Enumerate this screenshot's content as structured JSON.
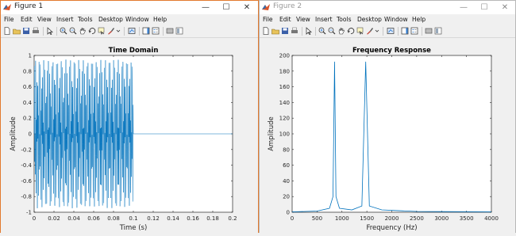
{
  "windows": [
    {
      "title": "Figure 1",
      "minimize": "—",
      "maximize": "☐",
      "close": "✕",
      "menus": [
        "File",
        "Edit",
        "View",
        "Insert",
        "Tools",
        "Desktop",
        "Window",
        "Help"
      ],
      "plot": {
        "title": "Time Domain",
        "xlabel": "Time (s)",
        "ylabel": "Amplitude",
        "xlim": [
          0,
          0.2
        ],
        "ylim": [
          -1,
          1
        ],
        "xticks": [
          "0",
          "0.02",
          "0.04",
          "0.06",
          "0.08",
          "0.1",
          "0.12",
          "0.14",
          "0.16",
          "0.18",
          "0.2"
        ],
        "yticks": [
          "-1",
          "-0.8",
          "-0.6",
          "-0.4",
          "-0.2",
          "0",
          "0.2",
          "0.4",
          "0.6",
          "0.8",
          "1"
        ],
        "line_color": "#0072bd"
      }
    },
    {
      "title": "Figure 2",
      "minimize": "—",
      "maximize": "☐",
      "close": "✕",
      "menus": [
        "File",
        "Edit",
        "View",
        "Insert",
        "Tools",
        "Desktop",
        "Window",
        "Help"
      ],
      "plot": {
        "title": "Frequency Response",
        "xlabel": "Frequency (Hz)",
        "ylabel": "Amplitude",
        "xlim": [
          0,
          4000
        ],
        "ylim": [
          0,
          200
        ],
        "xticks": [
          "0",
          "500",
          "1000",
          "1500",
          "2000",
          "2500",
          "3000",
          "3500",
          "4000"
        ],
        "yticks": [
          "0",
          "20",
          "40",
          "60",
          "80",
          "100",
          "120",
          "140",
          "160",
          "180",
          "200"
        ],
        "line_color": "#0072bd"
      }
    }
  ],
  "chart_data": [
    {
      "type": "line",
      "title": "Time Domain",
      "xlabel": "Time (s)",
      "ylabel": "Amplitude",
      "xlim": [
        0,
        0.2
      ],
      "ylim": [
        -1,
        1
      ],
      "series": [
        {
          "signal_duration_s": 0.1,
          "amplitude_peak": 0.95,
          "components_hz": [
            852,
            1477
          ],
          "value_after_0_1s": 0
        }
      ]
    },
    {
      "type": "line",
      "title": "Frequency Response",
      "xlabel": "Frequency (Hz)",
      "ylabel": "Amplitude",
      "xlim": [
        0,
        4000
      ],
      "ylim": [
        0,
        200
      ],
      "series": [
        {
          "x": [
            0,
            500,
            750,
            820,
            852,
            880,
            950,
            1200,
            1400,
            1477,
            1550,
            1800,
            2500,
            3000,
            4000
          ],
          "y": [
            0.5,
            1.5,
            5,
            20,
            192,
            20,
            5,
            3,
            8,
            192,
            8,
            3,
            1,
            0.8,
            0.5
          ]
        }
      ]
    }
  ]
}
